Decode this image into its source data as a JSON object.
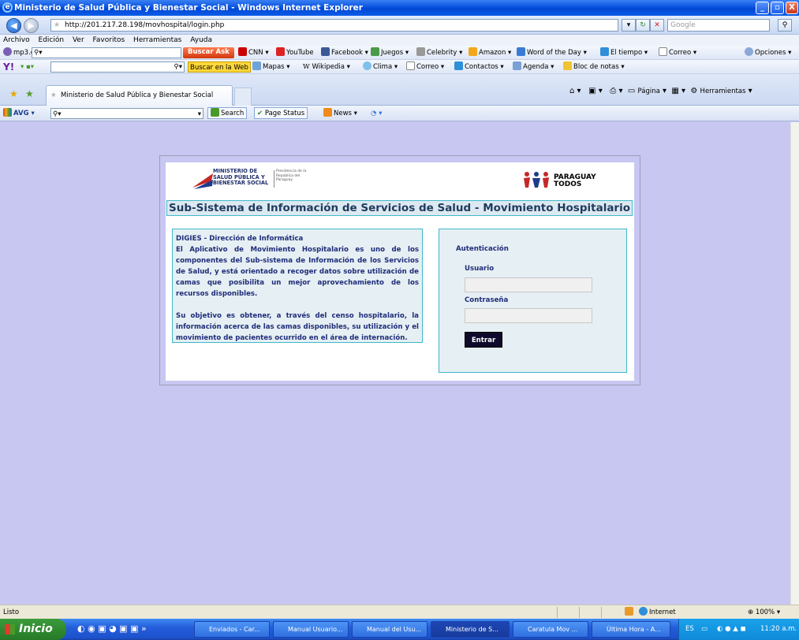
{
  "window": {
    "title": "Ministerio de Salud Pública y Bienestar Social - Windows Internet Explorer",
    "min": "_",
    "max": "▫",
    "close": "X"
  },
  "address": {
    "url": "http://201.217.28.198/movhospital/login.php",
    "search_placeholder": "Google"
  },
  "menu": [
    "Archivo",
    "Edición",
    "Ver",
    "Favoritos",
    "Herramientas",
    "Ayuda"
  ],
  "ask_toolbar": {
    "site": "mp3.es",
    "search_btn": "Buscar",
    "links": [
      "CNN",
      "YouTube",
      "Facebook",
      "Juegos",
      "Celebrity",
      "Amazon",
      "Word of the Day",
      "El tiempo",
      "Correo"
    ],
    "options": "Opciones"
  },
  "yahoo_toolbar": {
    "search_btn": "Buscar en la Web",
    "links": [
      "Mapas",
      "Wikipedia",
      "Clima",
      "Correo",
      "Contactos",
      "Agenda",
      "Bloc de notas"
    ]
  },
  "tabs": {
    "active": "Ministerio de Salud Pública y Bienestar Social",
    "cmd_page": "Página",
    "cmd_tools": "Herramientas"
  },
  "avg": {
    "brand": "AVG",
    "search": "Search",
    "page_status": "Page Status",
    "news": "News"
  },
  "page": {
    "logo_left": "MINISTERIO DE SALUD PÚBLICA Y BIENESTAR SOCIAL",
    "logo_right": "PARAGUAY TODOS",
    "banner": "Sub-Sistema de Información de Servicios de Salud - Movimiento Hospitalario",
    "info_title": "DIGIES - Dirección de Informática",
    "info_p1": "El Aplicativo de Movimiento Hospitalario es uno de los componentes del Sub-sistema de Información de los Servicios de Salud, y está orientado a recoger datos sobre utilización de camas que posibilita un mejor aprovechamiento de los recursos disponibles.",
    "info_p2": "Su objetivo es obtener, a través del censo hospitalario, la información acerca de las camas disponibles, su utilización y el movimiento de pacientes ocurrido en el área de internación.",
    "auth_title": "Autenticación",
    "user_label": "Usuario",
    "pass_label": "Contraseña",
    "submit": "Entrar"
  },
  "status": {
    "text": "Listo",
    "zone": "Internet",
    "zoom": "100%"
  },
  "taskbar": {
    "start": "Inicio",
    "tasks": [
      "Enviados - Car...",
      "Manual Usuario...",
      "Manual del Usu...",
      "Ministerio de S...",
      "Caratula Mov ...",
      "Última Hora - A..."
    ],
    "lang": "ES",
    "clock": "11:20 a.m."
  }
}
